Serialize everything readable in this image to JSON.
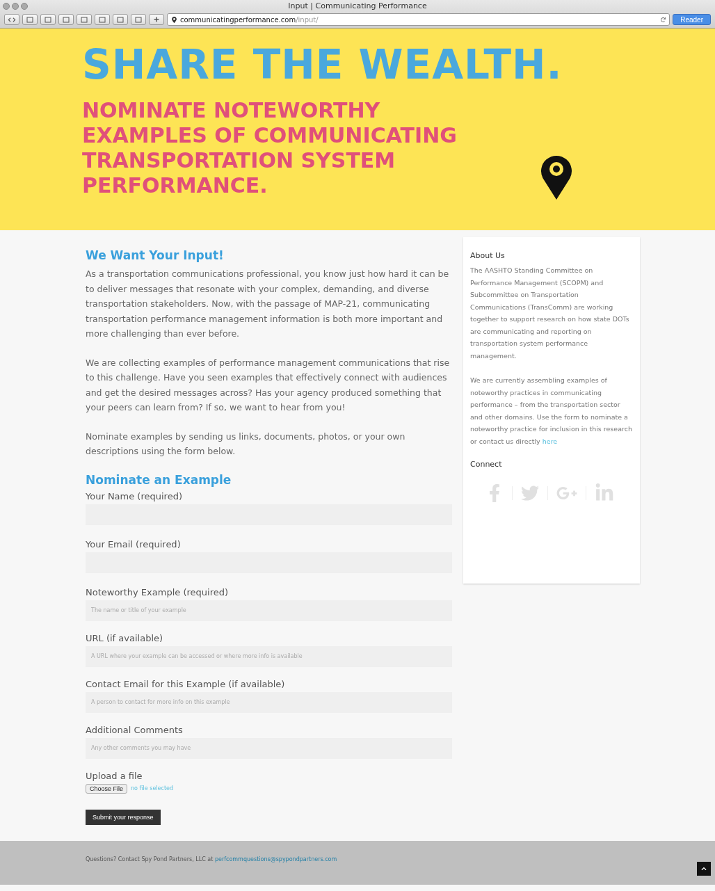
{
  "window": {
    "title": "Input | Communicating Performance"
  },
  "toolbar": {
    "url_host": "communicatingperformance.com",
    "url_path": "/input/",
    "reader": "Reader"
  },
  "banner": {
    "headline": "SHARE THE WEALTH.",
    "subhead": "NOMINATE NOTEWORTHY EXAMPLES OF COMMUNICATING TRANSPORTATION SYSTEM PERFORMANCE."
  },
  "intro": {
    "title": "We Want Your Input!",
    "paragraphs": [
      "As a transportation communications professional, you know just how hard it can be to deliver messages that resonate with your complex, demanding, and diverse transportation stakeholders. Now, with the passage of MAP-21, communicating transportation performance management information is both more important and more challenging than ever before.",
      "We are collecting examples of performance management communications that rise to this challenge. Have you seen examples that effectively connect with audiences and get the desired messages across? Has your agency produced something that your peers can learn from? If so, we want to hear from you!",
      "Nominate examples by sending us links, documents, photos, or your own descriptions using the form below."
    ]
  },
  "form": {
    "title": "Nominate an Example",
    "fields": [
      {
        "label": "Your Name (required)",
        "kind": "tall"
      },
      {
        "label": "Your Email (required)",
        "kind": "tall"
      },
      {
        "label": "Noteworthy Example (required)",
        "placeholder": "The name or title of your example",
        "kind": "short"
      },
      {
        "label": "URL (if available)",
        "placeholder": "A URL where your example can be accessed or where more info is available",
        "kind": "short"
      },
      {
        "label": "Contact Email for this Example (if available)",
        "placeholder": "A person to contact for more info on this example",
        "kind": "short"
      },
      {
        "label": "Additional Comments",
        "placeholder": "Any other comments you may have",
        "kind": "short"
      }
    ],
    "upload": {
      "label": "Upload a file",
      "button": "Choose File",
      "status": "no file selected"
    },
    "submit": "Submit your response"
  },
  "sidebar": {
    "about_title": "About Us",
    "about_paragraphs": [
      "The AASHTO Standing Committee on Performance Management (SCOPM) and Subcommittee on Transportation Communications (TransComm) are working together to support research on how state DOTs are communicating and reporting on transportation system performance management.",
      "We are currently assembling examples of noteworthy practices in communicating performance – from the transportation sector and other domains. Use the form to nominate a noteworthy practice for inclusion in this research or contact us directly"
    ],
    "about_link": "here",
    "connect_title": "Connect"
  },
  "footer": {
    "text": "Questions? Contact Spy Pond Partners, LLC at",
    "email": "perfcommquestions@spypondpartners.com"
  }
}
